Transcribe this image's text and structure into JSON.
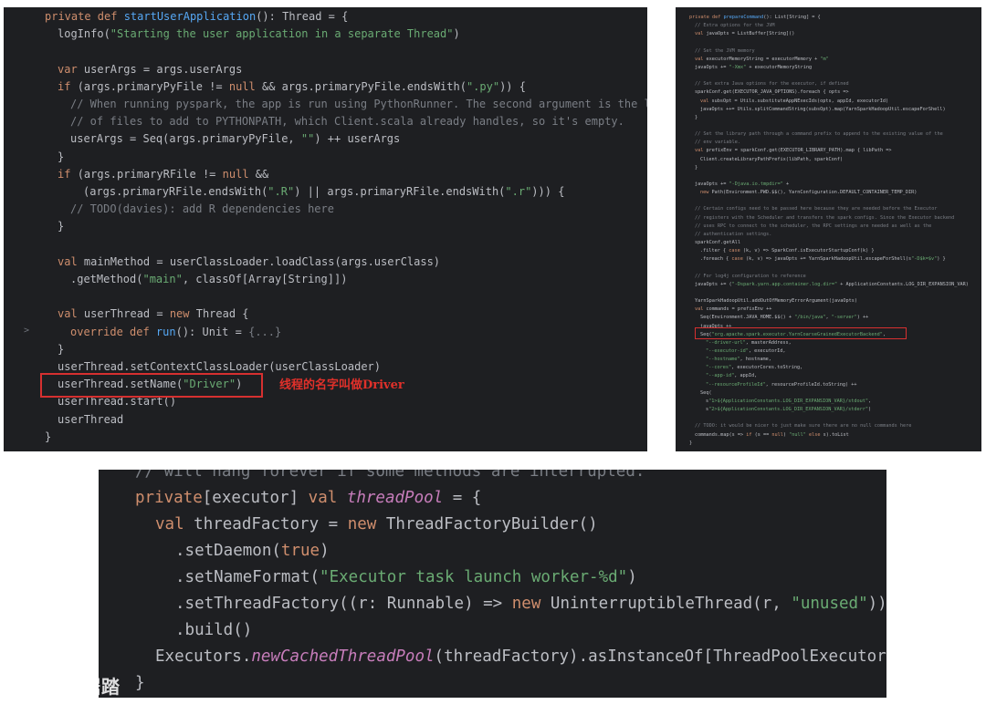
{
  "panel1": {
    "lines": [
      {
        "indent": 0,
        "segs": [
          [
            "kw",
            "private def "
          ],
          [
            "fn",
            "startUserApplication"
          ],
          [
            "id",
            "(): Thread = {"
          ]
        ]
      },
      {
        "indent": 1,
        "segs": [
          [
            "id",
            "logInfo("
          ],
          [
            "str",
            "\"Starting the user application in a separate Thread\""
          ],
          [
            "id",
            ")"
          ]
        ]
      },
      {
        "indent": 0,
        "segs": []
      },
      {
        "indent": 1,
        "segs": [
          [
            "kw",
            "var "
          ],
          [
            "id",
            "userArgs = args.userArgs"
          ]
        ]
      },
      {
        "indent": 1,
        "segs": [
          [
            "kw",
            "if "
          ],
          [
            "id",
            "(args.primaryPyFile != "
          ],
          [
            "kw",
            "null "
          ],
          [
            "id",
            "&& args.primaryPyFile.endsWith("
          ],
          [
            "str",
            "\".py\""
          ],
          [
            "id",
            ")) {"
          ]
        ]
      },
      {
        "indent": 2,
        "segs": [
          [
            "cmt",
            "// When running pyspark, the app is run using PythonRunner. The second argument is the list"
          ]
        ]
      },
      {
        "indent": 2,
        "segs": [
          [
            "cmt",
            "// of files to add to PYTHONPATH, which Client.scala already handles, so it's empty."
          ]
        ]
      },
      {
        "indent": 2,
        "segs": [
          [
            "id",
            "userArgs = Seq(args.primaryPyFile, "
          ],
          [
            "str",
            "\"\""
          ],
          [
            "id",
            ") ++ userArgs"
          ]
        ]
      },
      {
        "indent": 1,
        "segs": [
          [
            "id",
            "}"
          ]
        ]
      },
      {
        "indent": 1,
        "segs": [
          [
            "kw",
            "if "
          ],
          [
            "id",
            "(args.primaryRFile != "
          ],
          [
            "kw",
            "null "
          ],
          [
            "id",
            "&&"
          ]
        ]
      },
      {
        "indent": 3,
        "segs": [
          [
            "id",
            "(args.primaryRFile.endsWith("
          ],
          [
            "str",
            "\".R\""
          ],
          [
            "id",
            ") || args.primaryRFile.endsWith("
          ],
          [
            "str",
            "\".r\""
          ],
          [
            "id",
            "))) {"
          ]
        ]
      },
      {
        "indent": 2,
        "segs": [
          [
            "cmt",
            "// TODO(davies): add R dependencies here"
          ]
        ]
      },
      {
        "indent": 1,
        "segs": [
          [
            "id",
            "}"
          ]
        ]
      },
      {
        "indent": 0,
        "segs": []
      },
      {
        "indent": 1,
        "segs": [
          [
            "kw",
            "val "
          ],
          [
            "id",
            "mainMethod = userClassLoader.loadClass(args.userClass)"
          ]
        ]
      },
      {
        "indent": 2,
        "segs": [
          [
            "id",
            ".getMethod("
          ],
          [
            "str",
            "\"main\""
          ],
          [
            "id",
            ", classOf[Array[String]])"
          ]
        ]
      },
      {
        "indent": 0,
        "segs": []
      },
      {
        "indent": 1,
        "segs": [
          [
            "kw",
            "val "
          ],
          [
            "id",
            "userThread = "
          ],
          [
            "kw",
            "new "
          ],
          [
            "id",
            "Thread {"
          ]
        ]
      },
      {
        "indent": 2,
        "segs": [
          [
            "kw",
            "override def "
          ],
          [
            "fn",
            "run"
          ],
          [
            "id",
            "(): Unit = "
          ],
          [
            "cmt",
            "{...}"
          ]
        ]
      },
      {
        "indent": 1,
        "segs": [
          [
            "id",
            "}"
          ]
        ]
      },
      {
        "indent": 1,
        "segs": [
          [
            "id",
            "userThread.setContextClassLoader(userClassLoader)"
          ]
        ]
      },
      {
        "indent": 1,
        "segs": [
          [
            "id",
            "userThread.setName("
          ],
          [
            "str",
            "\"Driver\""
          ],
          [
            "id",
            ")"
          ]
        ]
      },
      {
        "indent": 1,
        "segs": [
          [
            "id",
            "userThread.start()"
          ]
        ]
      },
      {
        "indent": 1,
        "segs": [
          [
            "id",
            "userThread"
          ]
        ]
      },
      {
        "indent": 0,
        "segs": [
          [
            "id",
            "}"
          ]
        ]
      }
    ],
    "annotation": "线程的名字叫做Driver",
    "gutter_arrow": ">"
  },
  "panel2": {
    "lines": [
      {
        "indent": 0,
        "segs": [
          [
            "kw",
            "private def "
          ],
          [
            "fn",
            "prepareCommand"
          ],
          [
            "id",
            "(): List[String] = {"
          ]
        ]
      },
      {
        "indent": 1,
        "segs": [
          [
            "cmt",
            "// Extra options for the JVM"
          ]
        ]
      },
      {
        "indent": 1,
        "segs": [
          [
            "kw",
            "val "
          ],
          [
            "id",
            "javaOpts = ListBuffer[String]()"
          ]
        ]
      },
      {
        "indent": 0,
        "segs": []
      },
      {
        "indent": 1,
        "segs": [
          [
            "cmt",
            "// Set the JVM memory"
          ]
        ]
      },
      {
        "indent": 1,
        "segs": [
          [
            "kw",
            "val "
          ],
          [
            "id",
            "executorMemoryString = executorMemory + "
          ],
          [
            "str",
            "\"m\""
          ]
        ]
      },
      {
        "indent": 1,
        "segs": [
          [
            "id",
            "javaOpts += "
          ],
          [
            "str",
            "\"-Xmx\""
          ],
          [
            "id",
            " + executorMemoryString"
          ]
        ]
      },
      {
        "indent": 0,
        "segs": []
      },
      {
        "indent": 1,
        "segs": [
          [
            "cmt",
            "// Set extra Java options for the executor, if defined"
          ]
        ]
      },
      {
        "indent": 1,
        "segs": [
          [
            "id",
            "sparkConf.get(EXECUTOR_JAVA_OPTIONS).foreach { opts =>"
          ]
        ]
      },
      {
        "indent": 2,
        "segs": [
          [
            "kw",
            "val "
          ],
          [
            "id",
            "subsOpt = Utils.substituteAppNExecIds(opts, appId, executorId)"
          ]
        ]
      },
      {
        "indent": 2,
        "segs": [
          [
            "id",
            "javaOpts ++= Utils.splitCommandString(subsOpt).map(YarnSparkHadoopUtil.escapeForShell)"
          ]
        ]
      },
      {
        "indent": 1,
        "segs": [
          [
            "id",
            "}"
          ]
        ]
      },
      {
        "indent": 0,
        "segs": []
      },
      {
        "indent": 1,
        "segs": [
          [
            "cmt",
            "// Set the library path through a command prefix to append to the existing value of the"
          ]
        ]
      },
      {
        "indent": 1,
        "segs": [
          [
            "cmt",
            "// env variable."
          ]
        ]
      },
      {
        "indent": 1,
        "segs": [
          [
            "kw",
            "val "
          ],
          [
            "id",
            "prefixEnv = sparkConf.get(EXECUTOR_LIBRARY_PATH).map { libPath =>"
          ]
        ]
      },
      {
        "indent": 2,
        "segs": [
          [
            "id",
            "Client.createLibraryPathPrefix(libPath, sparkConf)"
          ]
        ]
      },
      {
        "indent": 1,
        "segs": [
          [
            "id",
            "}"
          ]
        ]
      },
      {
        "indent": 0,
        "segs": []
      },
      {
        "indent": 1,
        "segs": [
          [
            "id",
            "javaOpts += "
          ],
          [
            "str",
            "\"-Djava.io.tmpdir=\""
          ],
          [
            "id",
            " +"
          ]
        ]
      },
      {
        "indent": 2,
        "segs": [
          [
            "kw",
            "new "
          ],
          [
            "id",
            "Path(Environment.PWD.$$(), YarnConfiguration.DEFAULT_CONTAINER_TEMP_DIR)"
          ]
        ]
      },
      {
        "indent": 0,
        "segs": []
      },
      {
        "indent": 1,
        "segs": [
          [
            "cmt",
            "// Certain configs need to be passed here because they are needed before the Executor"
          ]
        ]
      },
      {
        "indent": 1,
        "segs": [
          [
            "cmt",
            "// registers with the Scheduler and transfers the spark configs. Since the Executor backend"
          ]
        ]
      },
      {
        "indent": 1,
        "segs": [
          [
            "cmt",
            "// uses RPC to connect to the scheduler, the RPC settings are needed as well as the"
          ]
        ]
      },
      {
        "indent": 1,
        "segs": [
          [
            "cmt",
            "// authentication settings."
          ]
        ]
      },
      {
        "indent": 1,
        "segs": [
          [
            "id",
            "sparkConf.getAll"
          ]
        ]
      },
      {
        "indent": 2,
        "segs": [
          [
            "id",
            ".filter { "
          ],
          [
            "kw",
            "case "
          ],
          [
            "id",
            "(k, v) => SparkConf.isExecutorStartupConf(k) }"
          ]
        ]
      },
      {
        "indent": 2,
        "segs": [
          [
            "id",
            ".foreach { "
          ],
          [
            "kw",
            "case "
          ],
          [
            "id",
            "(k, v) => javaOpts += YarnSparkHadoopUtil.escapeForShell(s"
          ],
          [
            "str",
            "\"-D$k=$v\""
          ],
          [
            "id",
            ") }"
          ]
        ]
      },
      {
        "indent": 0,
        "segs": []
      },
      {
        "indent": 1,
        "segs": [
          [
            "cmt",
            "// For log4j configuration to reference"
          ]
        ]
      },
      {
        "indent": 1,
        "segs": [
          [
            "id",
            "javaOpts += ("
          ],
          [
            "str",
            "\"-Dspark.yarn.app.container.log.dir=\""
          ],
          [
            "id",
            " + ApplicationConstants.LOG_DIR_EXPANSION_VAR)"
          ]
        ]
      },
      {
        "indent": 0,
        "segs": []
      },
      {
        "indent": 1,
        "segs": [
          [
            "id",
            "YarnSparkHadoopUtil.addOutOfMemoryErrorArgument(javaOpts)"
          ]
        ]
      },
      {
        "indent": 1,
        "segs": [
          [
            "kw",
            "val "
          ],
          [
            "id",
            "commands = prefixEnv ++"
          ]
        ]
      },
      {
        "indent": 2,
        "segs": [
          [
            "id",
            "Seq(Environment.JAVA_HOME.$$() + "
          ],
          [
            "str",
            "\"/bin/java\""
          ],
          [
            "id",
            ", "
          ],
          [
            "str",
            "\"-server\""
          ],
          [
            "id",
            ") ++"
          ]
        ]
      },
      {
        "indent": 2,
        "segs": [
          [
            "id",
            "javaOpts ++"
          ]
        ]
      },
      {
        "indent": 2,
        "segs": [
          [
            "id",
            "Seq("
          ],
          [
            "str",
            "\"org.apache.spark.executor.YarnCoarseGrainedExecutorBackend\""
          ],
          [
            "id",
            ","
          ]
        ]
      },
      {
        "indent": 3,
        "segs": [
          [
            "str",
            "\"--driver-url\""
          ],
          [
            "id",
            ", masterAddress,"
          ]
        ]
      },
      {
        "indent": 3,
        "segs": [
          [
            "str",
            "\"--executor-id\""
          ],
          [
            "id",
            ", executorId,"
          ]
        ]
      },
      {
        "indent": 3,
        "segs": [
          [
            "str",
            "\"--hostname\""
          ],
          [
            "id",
            ", hostname,"
          ]
        ]
      },
      {
        "indent": 3,
        "segs": [
          [
            "str",
            "\"--cores\""
          ],
          [
            "id",
            ", executorCores.toString,"
          ]
        ]
      },
      {
        "indent": 3,
        "segs": [
          [
            "str",
            "\"--app-id\""
          ],
          [
            "id",
            ", appId,"
          ]
        ]
      },
      {
        "indent": 3,
        "segs": [
          [
            "str",
            "\"--resourceProfileId\""
          ],
          [
            "id",
            ", resourceProfileId.toString) ++"
          ]
        ]
      },
      {
        "indent": 2,
        "segs": [
          [
            "id",
            "Seq("
          ]
        ]
      },
      {
        "indent": 3,
        "segs": [
          [
            "id",
            "s"
          ],
          [
            "str",
            "\"1>${ApplicationConstants.LOG_DIR_EXPANSION_VAR}/stdout\""
          ],
          [
            "id",
            ","
          ]
        ]
      },
      {
        "indent": 3,
        "segs": [
          [
            "id",
            "s"
          ],
          [
            "str",
            "\"2>${ApplicationConstants.LOG_DIR_EXPANSION_VAR}/stderr\""
          ],
          [
            "id",
            ")"
          ]
        ]
      },
      {
        "indent": 0,
        "segs": []
      },
      {
        "indent": 1,
        "segs": [
          [
            "cmt",
            "// TODO: it would be nicer to just make sure there are no null commands here"
          ]
        ]
      },
      {
        "indent": 1,
        "segs": [
          [
            "id",
            "commands.map(s => "
          ],
          [
            "kw",
            "if "
          ],
          [
            "id",
            "(s == "
          ],
          [
            "kw",
            "null"
          ],
          [
            "id",
            ") "
          ],
          [
            "str",
            "\"null\""
          ],
          [
            "id",
            " "
          ],
          [
            "kw",
            "else "
          ],
          [
            "id",
            "s).toList"
          ]
        ]
      },
      {
        "indent": 0,
        "segs": [
          [
            "id",
            "}"
          ]
        ]
      }
    ]
  },
  "panel3": {
    "lines": [
      {
        "indent": 0,
        "segs": [
          [
            "cmt",
            "// will hang forever if some methods are interrupted."
          ]
        ]
      },
      {
        "indent": 0,
        "segs": [
          [
            "kw",
            "private"
          ],
          [
            "id",
            "[executor] "
          ],
          [
            "kw",
            "val "
          ],
          [
            "ital",
            "threadPool"
          ],
          [
            "id",
            " = {"
          ]
        ]
      },
      {
        "indent": 1,
        "segs": [
          [
            "kw",
            "val "
          ],
          [
            "id",
            "threadFactory = "
          ],
          [
            "kw",
            "new "
          ],
          [
            "id",
            "ThreadFactoryBuilder()"
          ]
        ]
      },
      {
        "indent": 2,
        "segs": [
          [
            "id",
            ".setDaemon("
          ],
          [
            "kw",
            "true"
          ],
          [
            "id",
            ")"
          ]
        ]
      },
      {
        "indent": 2,
        "segs": [
          [
            "id",
            ".setNameFormat("
          ],
          [
            "str",
            "\"Executor task launch worker-%d\""
          ],
          [
            "id",
            ")"
          ]
        ]
      },
      {
        "indent": 2,
        "segs": [
          [
            "id",
            ".setThreadFactory((r: Runnable) => "
          ],
          [
            "kw",
            "new "
          ],
          [
            "id",
            "UninterruptibleThread(r, "
          ],
          [
            "str",
            "\"unused\""
          ],
          [
            "id",
            "))"
          ]
        ]
      },
      {
        "indent": 2,
        "segs": [
          [
            "id",
            ".build()"
          ]
        ]
      },
      {
        "indent": 1,
        "segs": [
          [
            "id",
            "Executors."
          ],
          [
            "ital",
            "newCachedThreadPool"
          ],
          [
            "id",
            "(threadFactory).asInstanceOf[ThreadPoolExecutor]"
          ]
        ]
      },
      {
        "indent": 0,
        "segs": [
          [
            "id",
            "}"
          ]
        ]
      }
    ]
  },
  "watermark": "大数据踏境"
}
